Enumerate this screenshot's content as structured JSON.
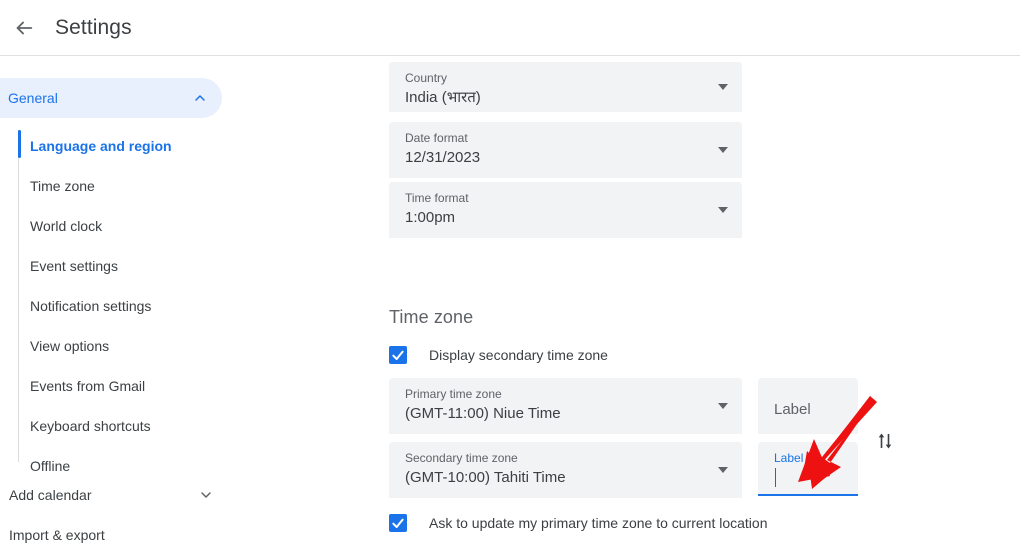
{
  "header": {
    "title": "Settings",
    "back_icon": "arrow-left-icon"
  },
  "sidebar": {
    "general": {
      "label": "General",
      "chevron_icon": "chevron-up-icon",
      "expanded": true
    },
    "items": [
      {
        "label": "Language and region",
        "active": true
      },
      {
        "label": "Time zone",
        "active": false
      },
      {
        "label": "World clock",
        "active": false
      },
      {
        "label": "Event settings",
        "active": false
      },
      {
        "label": "Notification settings",
        "active": false
      },
      {
        "label": "View options",
        "active": false
      },
      {
        "label": "Events from Gmail",
        "active": false
      },
      {
        "label": "Keyboard shortcuts",
        "active": false
      },
      {
        "label": "Offline",
        "active": false
      }
    ],
    "bottom_items": [
      {
        "label": "Add calendar",
        "chevron_icon": "chevron-down-icon",
        "has_chevron": true
      },
      {
        "label": "Import & export",
        "has_chevron": false
      }
    ]
  },
  "main": {
    "language_fields": [
      {
        "label": "Country",
        "value": "India (भारत)",
        "arrow_icon": "dropdown-arrow-icon"
      },
      {
        "label": "Date format",
        "value": "12/31/2023",
        "arrow_icon": "dropdown-arrow-icon"
      },
      {
        "label": "Time format",
        "value": "1:00pm",
        "arrow_icon": "dropdown-arrow-icon"
      }
    ],
    "timezone": {
      "section_title": "Time zone",
      "display_secondary": {
        "label": "Display secondary time zone",
        "checked": true,
        "check_icon": "checkmark-icon"
      },
      "primary": {
        "label": "Primary time zone",
        "value": "(GMT-11:00) Niue Time",
        "arrow_icon": "dropdown-arrow-icon"
      },
      "secondary": {
        "label": "Secondary time zone",
        "value": "(GMT-10:00) Tahiti Time",
        "arrow_icon": "dropdown-arrow-icon"
      },
      "primary_label_field": {
        "placeholder": "Label",
        "value": "",
        "focused": false
      },
      "secondary_label_field": {
        "placeholder": "Label",
        "value": "",
        "focused": true
      },
      "swap_icon": "swap-vertical-icon",
      "ask_update": {
        "label": "Ask to update my primary time zone to current location",
        "checked": true,
        "check_icon": "checkmark-icon"
      }
    }
  },
  "annotation": {
    "arrow_color": "#ee1111",
    "type": "pointer-arrow"
  },
  "colors": {
    "accent": "#1a73e8",
    "accent_bg": "#e8f0fe",
    "field_bg": "#f1f3f4",
    "text_primary": "#3c4043",
    "text_secondary": "#5f6368",
    "divider": "#dadce0"
  }
}
